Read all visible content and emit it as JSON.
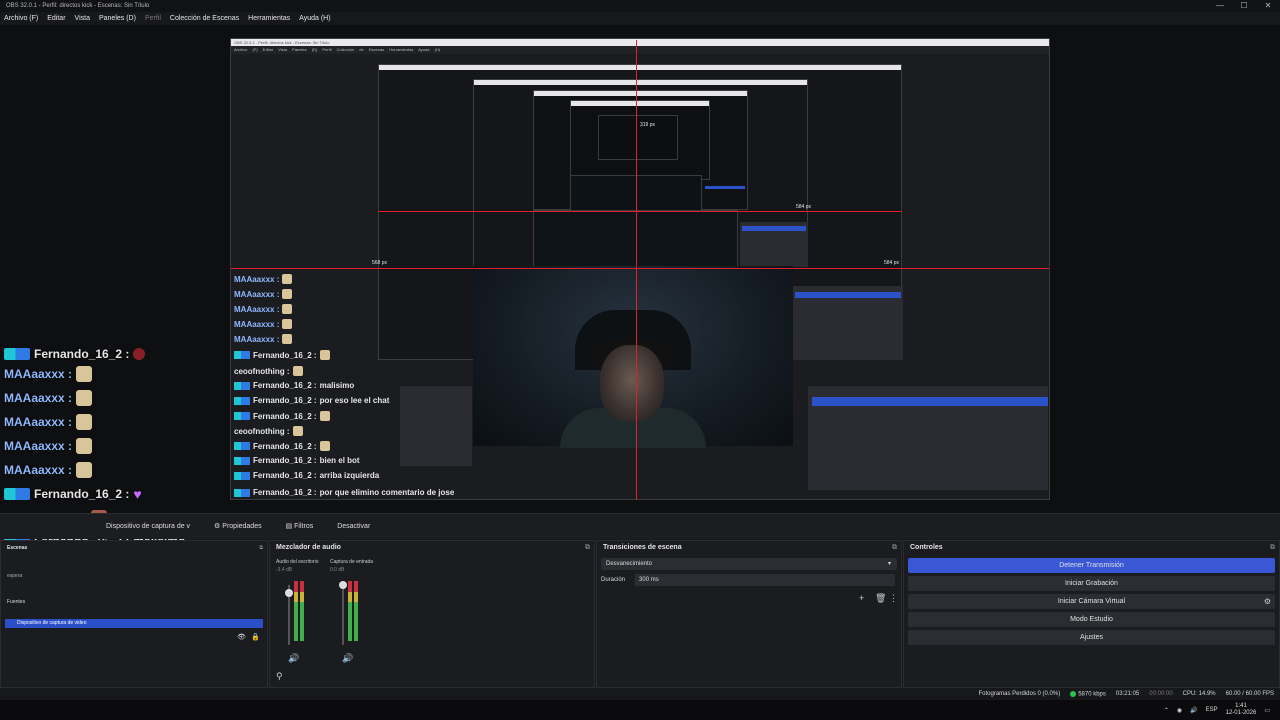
{
  "window": {
    "title": "OBS 32.0.1 - Perfil: directos kick - Escenas: Sin Título",
    "controls": [
      "—",
      "☐",
      "✕"
    ]
  },
  "menu": [
    "Archivo (F)",
    "Editar",
    "Vista",
    "Paneles (D)",
    "Perfil",
    "Colección de Escenas",
    "Herramientas",
    "Ayuda (H)"
  ],
  "preview": {
    "measure_top": "319 px",
    "measure_left": "568 px",
    "measure_right": "584 px",
    "measure_right_inner": "584 px"
  },
  "chat": [
    {
      "user": "Fernando_16_2 :",
      "text": "",
      "emote": "red"
    },
    {
      "user": "MAAaaxxx :",
      "text": "",
      "emote": "tile"
    },
    {
      "user": "MAAaaxxx :",
      "text": "",
      "emote": "tile"
    },
    {
      "user": "MAAaaxxx :",
      "text": "",
      "emote": "tile"
    },
    {
      "user": "MAAaaxxx :",
      "text": "",
      "emote": "tile"
    },
    {
      "user": "MAAaaxxx :",
      "text": "",
      "emote": "tile"
    },
    {
      "user": "Fernando_16_2 :",
      "text": "",
      "emote": "heart"
    },
    {
      "user": "ceoofnothing :",
      "text": "",
      "emote": "face"
    },
    {
      "user": "Fernando_16_2 :",
      "text": "malisimo",
      "emote": ""
    },
    {
      "user": "Fernando_16_2 :",
      "text": "por eso lee el chat",
      "emote": ""
    },
    {
      "user": "Fernando_16_2 :",
      "text": "",
      "emote": "heart"
    },
    {
      "user": "ceoofnothing :",
      "text": "",
      "emote": "face"
    },
    {
      "user": "Fernando_16_2 :",
      "text": "",
      "emote": "heart"
    },
    {
      "user": "Fernando_16_2 :",
      "text": "bien el bot",
      "emote": ""
    },
    {
      "user": "Fernando_16_2 :",
      "text": "arriba izquierda",
      "emote": ""
    },
    {
      "user": "Fernando_16_2 :",
      "text": "por que elimino comentario de jose",
      "emote": "red"
    }
  ],
  "mini_chat": [
    {
      "user": "MAAaaxxx :",
      "text": ""
    },
    {
      "user": "MAAaaxxx :",
      "text": ""
    },
    {
      "user": "MAAaaxxx :",
      "text": ""
    },
    {
      "user": "MAAaaxxx :",
      "text": ""
    },
    {
      "user": "MAAaaxxx :",
      "text": ""
    },
    {
      "user": "Fernando_16_2 :",
      "text": ""
    },
    {
      "user": "ceoofnothing :",
      "text": ""
    },
    {
      "user": "Fernando_16_2 :",
      "text": "malisimo"
    },
    {
      "user": "Fernando_16_2 :",
      "text": "por eso lee el chat"
    },
    {
      "user": "Fernando_16_2 :",
      "text": ""
    },
    {
      "user": "ceoofnothing :",
      "text": ""
    },
    {
      "user": "Fernando_16_2 :",
      "text": ""
    },
    {
      "user": "Fernando_16_2 :",
      "text": "bien el bot"
    },
    {
      "user": "Fernando_16_2 :",
      "text": "arriba izquierda"
    },
    {
      "user": "Fernando_16_2 :",
      "text": "por que elimino comentario de jose"
    }
  ],
  "source_toolbar": {
    "source_name": "Dispositivo de captura de v",
    "properties": "Propiedades",
    "filters": "Filtros",
    "deactivate": "Desactivar"
  },
  "docks": {
    "scenes": {
      "title": "Escenas",
      "sources_title": "Fuentes",
      "source_item": "Dispositivo de captura de video",
      "scene_item": "espera"
    },
    "mixer": {
      "title": "Mezclador de audio",
      "ch1": "Audio del escritorio",
      "ch1_db": "-3.4 dB",
      "ch2": "Captura de entrada",
      "ch2_db": "0.0 dB"
    },
    "transitions": {
      "title": "Transiciones de escena",
      "selected": "Desvanecimiento",
      "duration_label": "Duración",
      "duration_value": "300 ms"
    },
    "controls": {
      "title": "Controles",
      "stop_stream": "Detener Transmisión",
      "start_recording": "Iniciar Grabación",
      "virtual_cam": "Iniciar Cámara Virtual",
      "studio_mode": "Modo Estudio",
      "settings": "Ajustes"
    }
  },
  "status": {
    "dropped": "Fotogramas Perdidos 0 (0.0%)",
    "bitrate": "5870 kbps",
    "stream_time": "03:21:05",
    "rec_time": "00:00:00",
    "cpu": "CPU: 14.9%",
    "fps": "60.00 / 60.00 FPS"
  },
  "taskbar": {
    "lang": "ESP",
    "time": "1:41",
    "date": "12-01-2026"
  },
  "colors": {
    "accent": "#3a57d6",
    "guide": "#e0202a",
    "bg": "#17181b"
  }
}
